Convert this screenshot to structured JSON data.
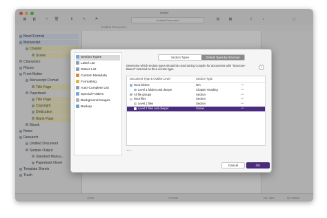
{
  "window": {
    "title": "Novel",
    "doc_title": "Untitled Document",
    "sub_doc": "Untitled Document"
  },
  "binder": [
    {
      "label": "Novel Format",
      "indent": 0,
      "style": "blue"
    },
    {
      "label": "Manuscript",
      "indent": 0,
      "style": "blue"
    },
    {
      "label": "Chapter",
      "indent": 1,
      "style": "hl"
    },
    {
      "label": "Scene",
      "indent": 2,
      "style": "hl"
    },
    {
      "label": "Characters",
      "indent": 0,
      "style": ""
    },
    {
      "label": "Places",
      "indent": 0,
      "style": ""
    },
    {
      "label": "Front Matter",
      "indent": 0,
      "style": ""
    },
    {
      "label": "Manuscript Format",
      "indent": 1,
      "style": ""
    },
    {
      "label": "Title Page",
      "indent": 2,
      "style": "hl"
    },
    {
      "label": "Paperback",
      "indent": 1,
      "style": ""
    },
    {
      "label": "Title Page",
      "indent": 2,
      "style": "hl"
    },
    {
      "label": "Copyright",
      "indent": 2,
      "style": "hl"
    },
    {
      "label": "Dedication",
      "indent": 2,
      "style": "hl"
    },
    {
      "label": "Blank Page",
      "indent": 2,
      "style": "hl"
    },
    {
      "label": "Ebook",
      "indent": 1,
      "style": ""
    },
    {
      "label": "Notes",
      "indent": 0,
      "style": ""
    },
    {
      "label": "Research",
      "indent": 0,
      "style": ""
    },
    {
      "label": "Untitled Document",
      "indent": 1,
      "style": ""
    },
    {
      "label": "Sample Output",
      "indent": 1,
      "style": ""
    },
    {
      "label": "Standard Manus...",
      "indent": 2,
      "style": ""
    },
    {
      "label": "Paperback Novel",
      "indent": 2,
      "style": ""
    },
    {
      "label": "Template Sheets",
      "indent": 0,
      "style": ""
    },
    {
      "label": "Trash",
      "indent": 0,
      "style": ""
    }
  ],
  "footer": {
    "zoom": "100%",
    "words": "0 words",
    "label": "No Label",
    "status": "No Status"
  },
  "dialog": {
    "sidebar": [
      {
        "label": "Section Types",
        "color": "#7aa7d8",
        "selected": true
      },
      {
        "label": "Label List",
        "color": "#8aa0b8"
      },
      {
        "label": "Status List",
        "color": "#8aa0b8"
      },
      {
        "label": "Custom Metadata",
        "color": "#e08a3c"
      },
      {
        "label": "Formatting",
        "color": "#d9b640"
      },
      {
        "label": "Auto-Complete List",
        "color": "#8aa0b8"
      },
      {
        "label": "Special Folders",
        "color": "#7aa7d8"
      },
      {
        "label": "Background Images",
        "color": "#b0b0b0"
      },
      {
        "label": "Backup",
        "color": "#6f9fd0"
      }
    ],
    "tabs": [
      "Section Types",
      "Default Types by Structure"
    ],
    "active_tab": 1,
    "description": "Determine which section types should be used during Compile for documents with \"Structure-Based\" selected as their section type.",
    "help": "?",
    "columns": [
      "Document Type & Outline Level",
      "Section Type"
    ],
    "rows": [
      {
        "label": "Root folders",
        "type": "N/A",
        "indent": 0,
        "icon": "folder"
      },
      {
        "label": "Level 1 folders and deeper",
        "type": "Chapter Heading",
        "indent": 1,
        "icon": "folder"
      },
      {
        "label": "All file groups",
        "type": "Section",
        "indent": 0,
        "icon": "stack"
      },
      {
        "label": "Root files",
        "type": "Section",
        "indent": 0,
        "icon": "file"
      },
      {
        "label": "Level 1 files",
        "type": "Section",
        "indent": 1,
        "icon": "file"
      },
      {
        "label": "Level 2 files and deeper",
        "type": "Scene",
        "indent": 1,
        "icon": "file",
        "selected": true
      }
    ],
    "table_footer": "+ / −",
    "cancel": "Cancel",
    "ok": "OK"
  }
}
